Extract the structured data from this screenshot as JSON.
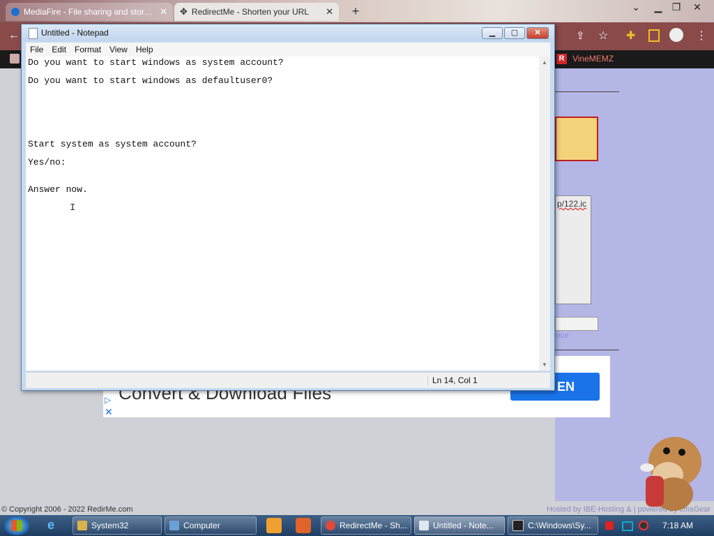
{
  "browser": {
    "tabs": [
      {
        "title": "MediaFire - File sharing and storage",
        "close": "✕"
      },
      {
        "title": "RedirectMe - Shorten your URL",
        "close": "✕"
      }
    ],
    "new_tab": "+",
    "bookmark": {
      "icon_letter": "R",
      "label": "VineMEMZ"
    }
  },
  "page": {
    "url_snippet": "p/122.ic",
    "link_text": "vice",
    "ad_title": "Convert & Download Files",
    "ad_button": "EN",
    "copyright": "© Copyright 2006 - 2022 RedirMe.com",
    "hosted": "Hosted by IBE-Hosting & | powered by cmsGear"
  },
  "notepad": {
    "title": "Untitled - Notepad",
    "menu": [
      "File",
      "Edit",
      "Format",
      "View",
      "Help"
    ],
    "text": "Do you want to start windows as system account?\n\nDo you want to start windows as defaultuser0?\n\n\n\n\n\n\nStart system as system account?\n\nYes/no:\n\n\nAnswer now.",
    "status": "Ln 14, Col 1",
    "buttons": {
      "min": "▁",
      "max": "▢",
      "close": "✕"
    }
  },
  "taskbar": {
    "items": [
      {
        "label": "System32",
        "color": "#d9b24a"
      },
      {
        "label": "Computer",
        "color": "#6aa0d8"
      },
      {
        "label": "RedirectMe - Sh...",
        "color": "#e04a3a"
      },
      {
        "label": "Untitled - Note...",
        "color": "#dfe8f2"
      },
      {
        "label": "C:\\Windows\\Sy...",
        "color": "#222222"
      }
    ],
    "clock": "7:18 AM"
  }
}
